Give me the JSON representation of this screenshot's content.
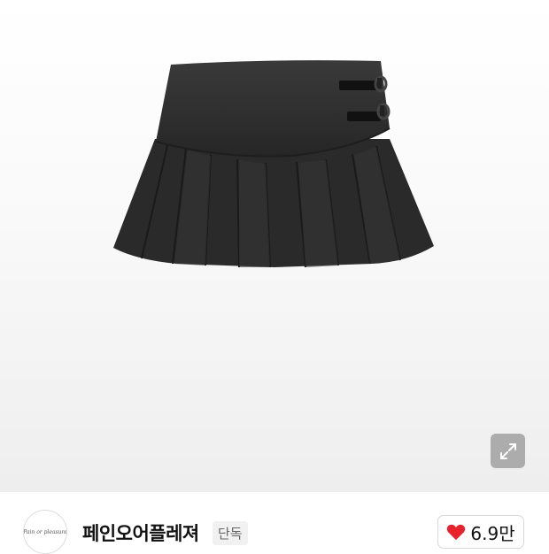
{
  "product": {
    "image_alt": "black pleated mini skirt with double buckle straps"
  },
  "brand": {
    "name": "페인오어플레져",
    "logo_text": "Pain or pleasure",
    "badge": "단독"
  },
  "like": {
    "count": "6.9만",
    "icon": "heart-icon",
    "color": "#e8222d"
  },
  "expand": {
    "icon": "expand-icon"
  }
}
